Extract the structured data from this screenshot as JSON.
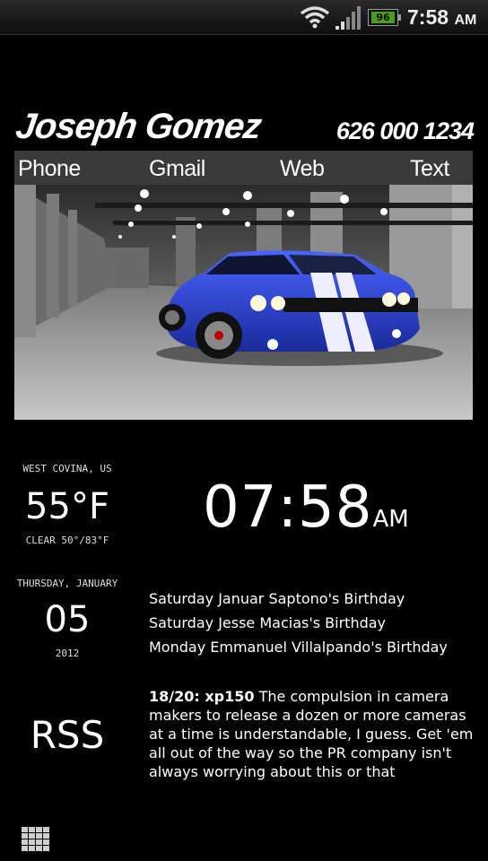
{
  "status_bar": {
    "battery": "96",
    "time": "7:58",
    "time_ampm": "AM",
    "icons": [
      "wifi-icon",
      "signal-icon",
      "battery-icon"
    ]
  },
  "contact": {
    "name": "Joseph Gomez",
    "number": "626 000 1234"
  },
  "actions": {
    "phone": "Phone",
    "gmail": "Gmail",
    "web": "Web",
    "text": "Text"
  },
  "weather": {
    "location": "WEST COVINA, US",
    "temperature": "55°F",
    "condition": "CLEAR 50°/83°F"
  },
  "clock": {
    "time": "07:58",
    "ampm": "AM"
  },
  "date": {
    "weekday_month": "THURSDAY, JANUARY",
    "day": "05",
    "year": "2012"
  },
  "events": [
    "Saturday Januar Saptono's Birthday",
    "Saturday Jesse Macias's Birthday",
    "Monday Emmanuel Villalpando's Birthday"
  ],
  "rss": {
    "label": "RSS",
    "title": "18/20: xp150",
    "body": "The compulsion in camera makers to release a dozen or more cameras at a time is understandable, I guess. Get 'em all out of the way so the PR company isn't always worrying about this or that"
  },
  "colors": {
    "background": "#000000",
    "car_body": "#2a3fc7",
    "action_bar": "#3a3a3a",
    "battery": "#4c9a1f"
  }
}
